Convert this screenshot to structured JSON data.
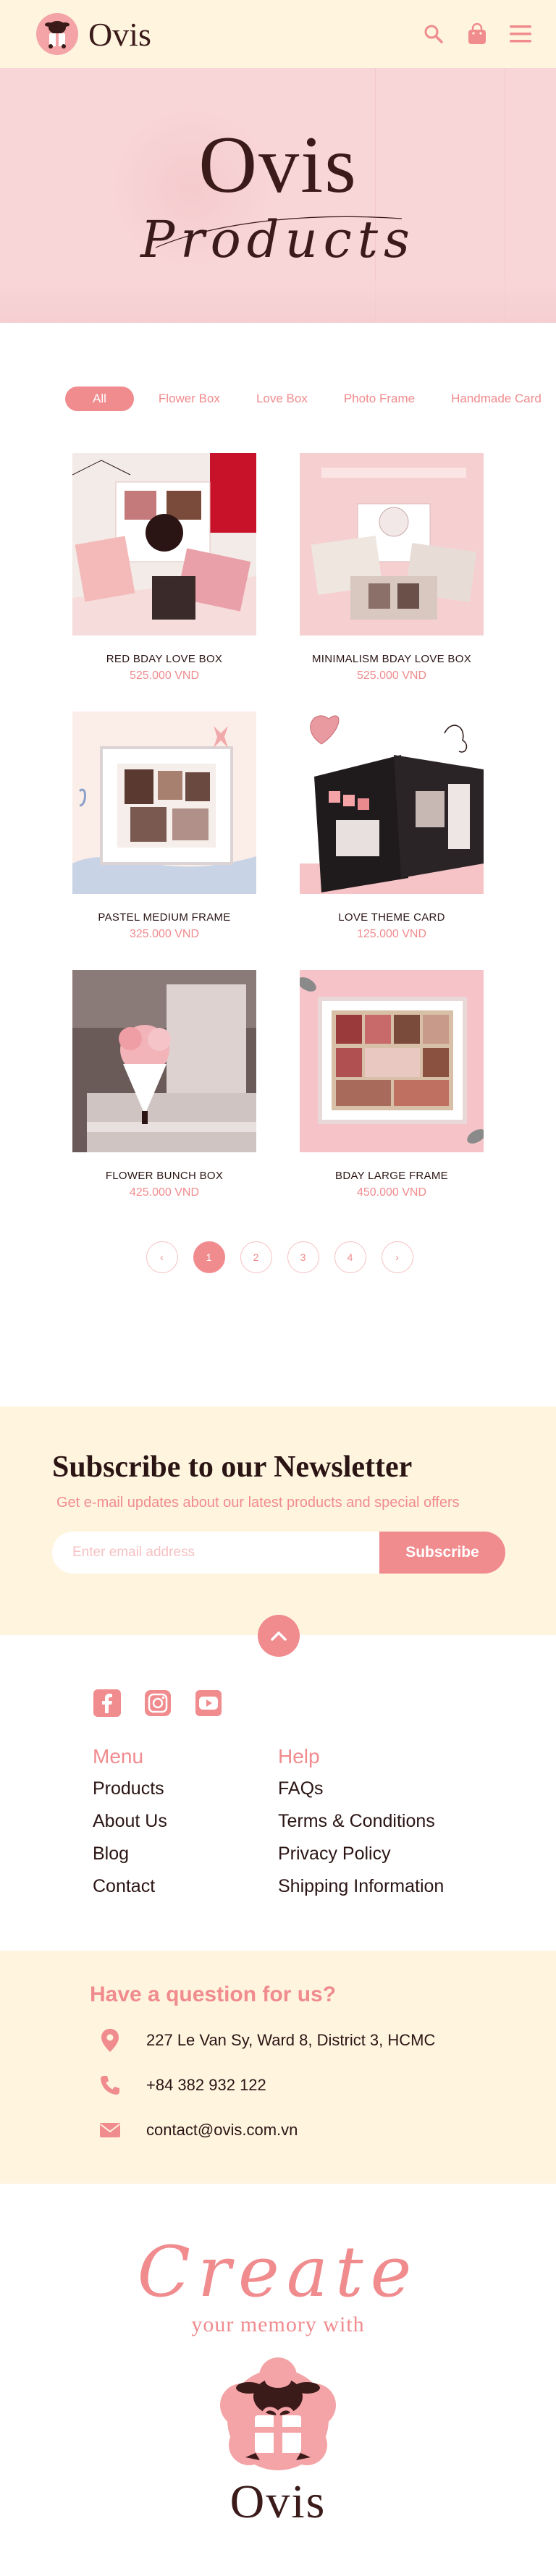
{
  "header": {
    "brand": "Ovis",
    "icons": [
      "search-icon",
      "shopping-bag-icon",
      "menu-icon"
    ]
  },
  "hero": {
    "title": "Ovis",
    "subtitle": "Products"
  },
  "filters": {
    "items": [
      "All",
      "Flower Box",
      "Love Box",
      "Photo Frame",
      "Handmade Card"
    ],
    "active": "All"
  },
  "products": [
    {
      "name": "RED BDAY LOVE BOX",
      "price": "525.000 VND"
    },
    {
      "name": "MINIMALISM BDAY LOVE BOX",
      "price": "525.000 VND"
    },
    {
      "name": "PASTEL MEDIUM FRAME",
      "price": "325.000 VND"
    },
    {
      "name": "LOVE THEME CARD",
      "price": "125.000 VND"
    },
    {
      "name": "FLOWER BUNCH BOX",
      "price": "425.000 VND"
    },
    {
      "name": "BDAY LARGE FRAME",
      "price": "450.000 VND"
    }
  ],
  "pagination": {
    "prev": "‹",
    "pages": [
      "1",
      "2",
      "3",
      "4"
    ],
    "next": "›",
    "current": "1"
  },
  "newsletter": {
    "title": "Subscribe to our Newsletter",
    "description": "Get e-mail updates about our latest products and special offers",
    "email_placeholder": "Enter email address",
    "email_value": "",
    "button": "Subscribe"
  },
  "social": [
    "facebook-icon",
    "instagram-icon",
    "youtube-icon"
  ],
  "footer": {
    "menu_title": "Menu",
    "menu": [
      "Products",
      "About Us",
      "Blog",
      "Contact"
    ],
    "help_title": "Help",
    "help": [
      "FAQs",
      "Terms & Conditions",
      "Privacy Policy",
      "Shipping Information"
    ]
  },
  "contact": {
    "title": "Have a question for us?",
    "address": "227 Le Van Sy, Ward 8,  District 3, HCMC",
    "phone": "+84 382 932 122",
    "email": "contact@ovis.com.vn"
  },
  "brand_footer": {
    "create": "Create",
    "tagline": "your memory with",
    "name": "Ovis"
  },
  "colors": {
    "accent": "#f08b8e",
    "cream": "#fff5df",
    "hero_pink": "#f8d6d8",
    "text_dark": "#3b1a1a"
  }
}
